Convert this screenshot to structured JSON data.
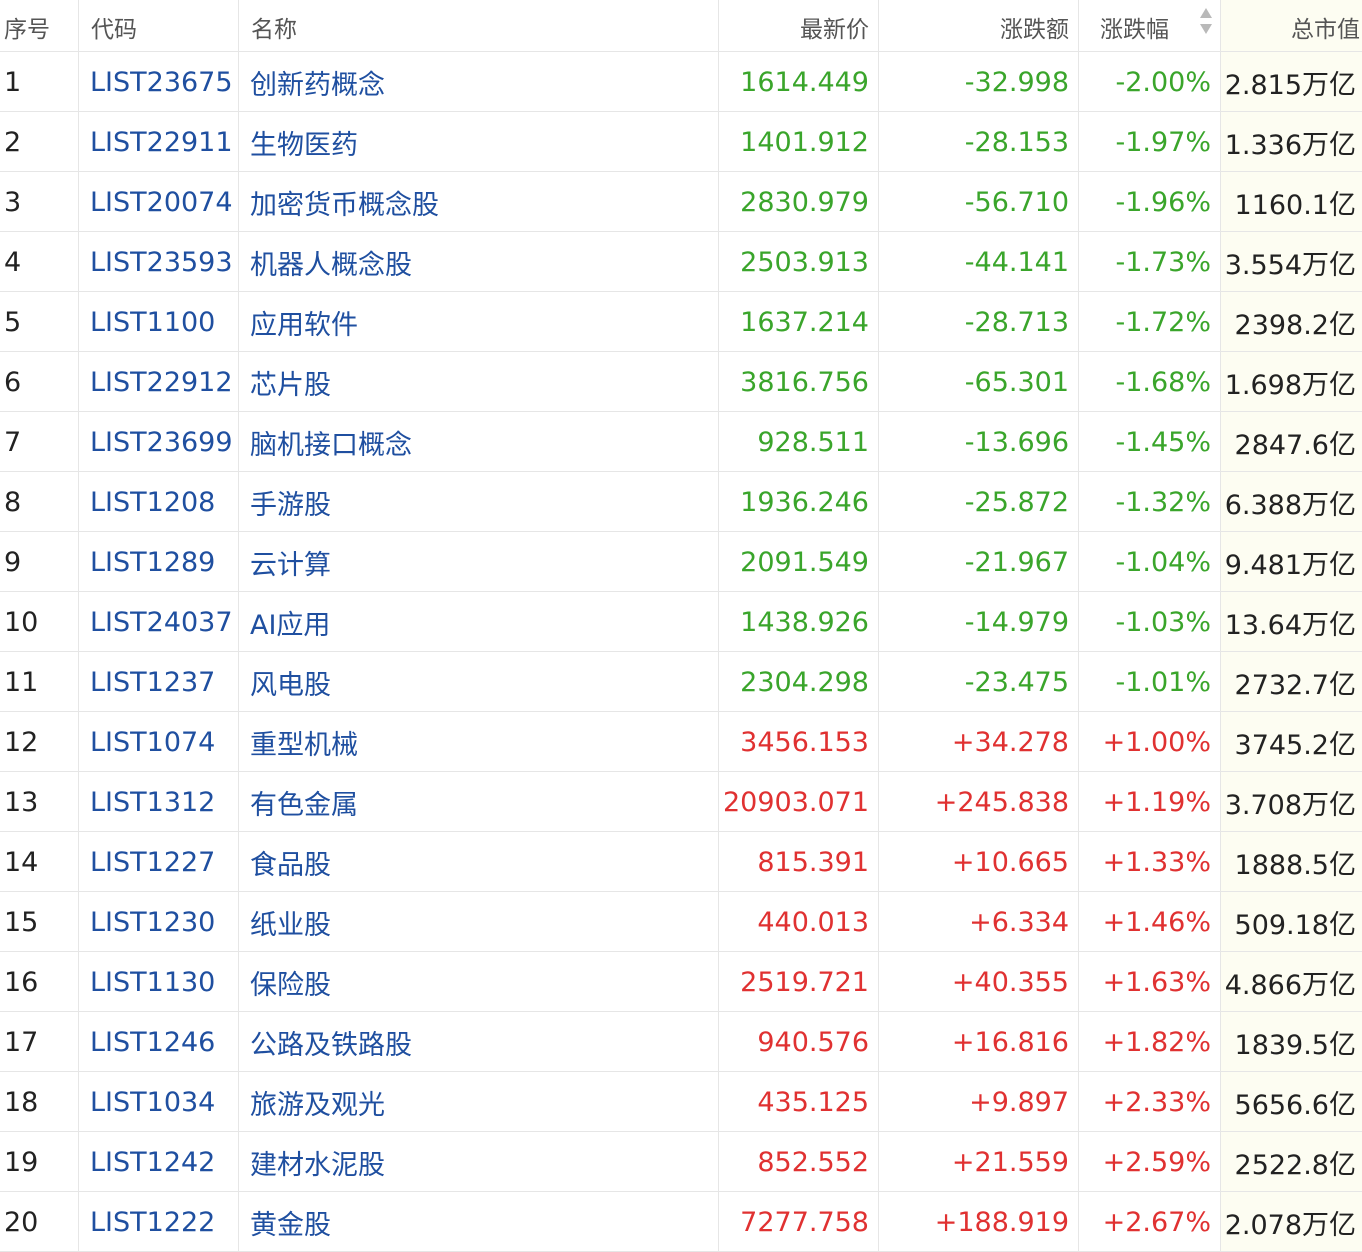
{
  "table": {
    "headers": {
      "index": "序号",
      "code": "代码",
      "name": "名称",
      "price": "最新价",
      "change": "涨跌额",
      "change_pct": "涨跌幅",
      "market_cap": "总市值"
    },
    "sort_column": "涨跌幅",
    "colors": {
      "up": "#e03131",
      "down": "#3aa52b",
      "link": "#1f4fa0",
      "cap_background": "#fdfdf2"
    },
    "rows": [
      {
        "idx": "1",
        "code": "LIST23675",
        "name": "创新药概念",
        "price": "1614.449",
        "change": "-32.998",
        "pct": "-2.00%",
        "cap": "2.815万亿",
        "dir": "down"
      },
      {
        "idx": "2",
        "code": "LIST22911",
        "name": "生物医药",
        "price": "1401.912",
        "change": "-28.153",
        "pct": "-1.97%",
        "cap": "1.336万亿",
        "dir": "down"
      },
      {
        "idx": "3",
        "code": "LIST20074",
        "name": "加密货币概念股",
        "price": "2830.979",
        "change": "-56.710",
        "pct": "-1.96%",
        "cap": "1160.1亿",
        "dir": "down"
      },
      {
        "idx": "4",
        "code": "LIST23593",
        "name": "机器人概念股",
        "price": "2503.913",
        "change": "-44.141",
        "pct": "-1.73%",
        "cap": "3.554万亿",
        "dir": "down"
      },
      {
        "idx": "5",
        "code": "LIST1100",
        "name": "应用软件",
        "price": "1637.214",
        "change": "-28.713",
        "pct": "-1.72%",
        "cap": "2398.2亿",
        "dir": "down"
      },
      {
        "idx": "6",
        "code": "LIST22912",
        "name": "芯片股",
        "price": "3816.756",
        "change": "-65.301",
        "pct": "-1.68%",
        "cap": "1.698万亿",
        "dir": "down"
      },
      {
        "idx": "7",
        "code": "LIST23699",
        "name": "脑机接口概念",
        "price": "928.511",
        "change": "-13.696",
        "pct": "-1.45%",
        "cap": "2847.6亿",
        "dir": "down"
      },
      {
        "idx": "8",
        "code": "LIST1208",
        "name": "手游股",
        "price": "1936.246",
        "change": "-25.872",
        "pct": "-1.32%",
        "cap": "6.388万亿",
        "dir": "down"
      },
      {
        "idx": "9",
        "code": "LIST1289",
        "name": "云计算",
        "price": "2091.549",
        "change": "-21.967",
        "pct": "-1.04%",
        "cap": "9.481万亿",
        "dir": "down"
      },
      {
        "idx": "10",
        "code": "LIST24037",
        "name": "AI应用",
        "price": "1438.926",
        "change": "-14.979",
        "pct": "-1.03%",
        "cap": "13.64万亿",
        "dir": "down"
      },
      {
        "idx": "11",
        "code": "LIST1237",
        "name": "风电股",
        "price": "2304.298",
        "change": "-23.475",
        "pct": "-1.01%",
        "cap": "2732.7亿",
        "dir": "down"
      },
      {
        "idx": "12",
        "code": "LIST1074",
        "name": "重型机械",
        "price": "3456.153",
        "change": "+34.278",
        "pct": "+1.00%",
        "cap": "3745.2亿",
        "dir": "up"
      },
      {
        "idx": "13",
        "code": "LIST1312",
        "name": "有色金属",
        "price": "20903.071",
        "change": "+245.838",
        "pct": "+1.19%",
        "cap": "3.708万亿",
        "dir": "up"
      },
      {
        "idx": "14",
        "code": "LIST1227",
        "name": "食品股",
        "price": "815.391",
        "change": "+10.665",
        "pct": "+1.33%",
        "cap": "1888.5亿",
        "dir": "up"
      },
      {
        "idx": "15",
        "code": "LIST1230",
        "name": "纸业股",
        "price": "440.013",
        "change": "+6.334",
        "pct": "+1.46%",
        "cap": "509.18亿",
        "dir": "up"
      },
      {
        "idx": "16",
        "code": "LIST1130",
        "name": "保险股",
        "price": "2519.721",
        "change": "+40.355",
        "pct": "+1.63%",
        "cap": "4.866万亿",
        "dir": "up"
      },
      {
        "idx": "17",
        "code": "LIST1246",
        "name": "公路及铁路股",
        "price": "940.576",
        "change": "+16.816",
        "pct": "+1.82%",
        "cap": "1839.5亿",
        "dir": "up"
      },
      {
        "idx": "18",
        "code": "LIST1034",
        "name": "旅游及观光",
        "price": "435.125",
        "change": "+9.897",
        "pct": "+2.33%",
        "cap": "5656.6亿",
        "dir": "up"
      },
      {
        "idx": "19",
        "code": "LIST1242",
        "name": "建材水泥股",
        "price": "852.552",
        "change": "+21.559",
        "pct": "+2.59%",
        "cap": "2522.8亿",
        "dir": "up"
      },
      {
        "idx": "20",
        "code": "LIST1222",
        "name": "黄金股",
        "price": "7277.758",
        "change": "+188.919",
        "pct": "+2.67%",
        "cap": "2.078万亿",
        "dir": "up"
      }
    ]
  }
}
